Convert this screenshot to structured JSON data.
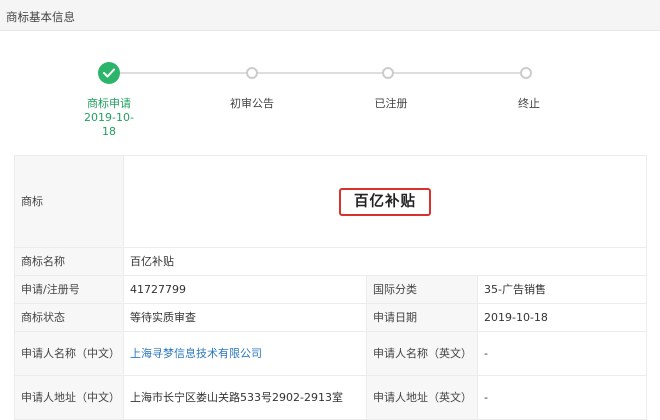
{
  "header": {
    "title": "商标基本信息"
  },
  "steps": [
    {
      "label": "商标申请",
      "date": "2019-10-18",
      "status": "done"
    },
    {
      "label": "初审公告",
      "status": "pending"
    },
    {
      "label": "已注册",
      "status": "pending"
    },
    {
      "label": "终止",
      "status": "pending"
    }
  ],
  "info": {
    "trademark_label": "商标",
    "trademark_text": "百亿补贴",
    "name_label": "商标名称",
    "name_value": "百亿补贴",
    "reg_no_label": "申请/注册号",
    "reg_no_value": "41727799",
    "intl_class_label": "国际分类",
    "intl_class_value": "35-广告销售",
    "status_label": "商标状态",
    "status_value": "等待实质审查",
    "apply_date_label": "申请日期",
    "apply_date_value": "2019-10-18",
    "applicant_cn_label": "申请人名称（中文）",
    "applicant_cn_value": "上海寻梦信息技术有限公司",
    "applicant_en_label": "申请人名称（英文）",
    "applicant_en_value": "-",
    "address_cn_label": "申请人地址（中文）",
    "address_cn_value": "上海市长宁区娄山关路533号2902-2913室",
    "address_en_label": "申请人地址（英文）",
    "address_en_value": "-"
  },
  "colors": {
    "done": "#2bb56a",
    "highlight_border": "#d9322b",
    "link": "#2b78c2"
  }
}
